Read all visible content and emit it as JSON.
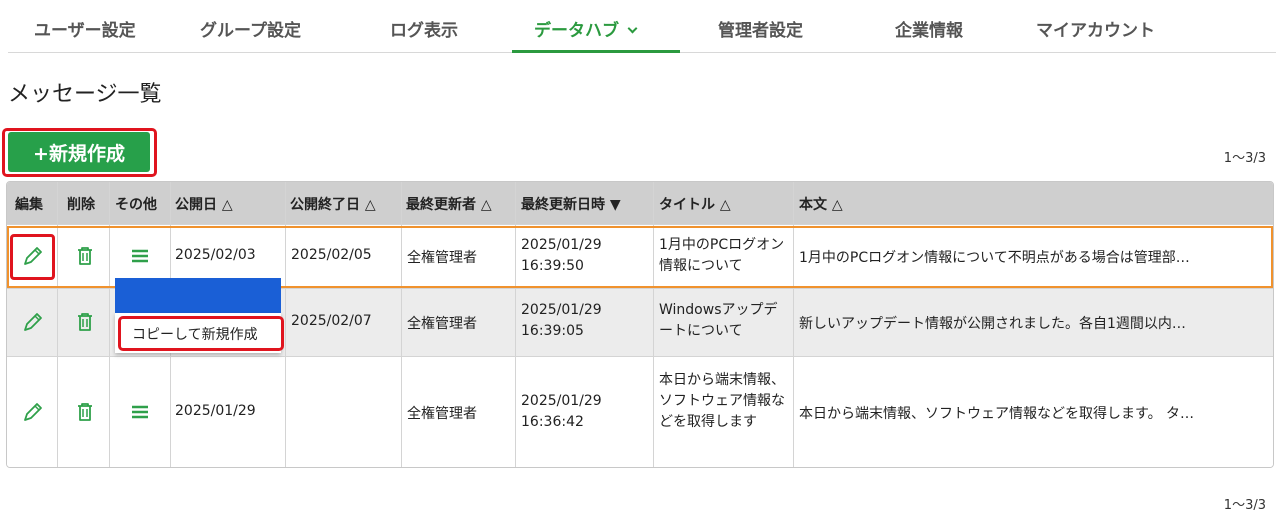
{
  "nav": {
    "items": [
      {
        "label": "ユーザー設定"
      },
      {
        "label": "グループ設定"
      },
      {
        "label": "ログ表示"
      },
      {
        "label": "データハブ"
      },
      {
        "label": "管理者設定"
      },
      {
        "label": "企業情報"
      },
      {
        "label": "マイアカウント"
      }
    ],
    "active": "データハブ"
  },
  "page": {
    "title": "メッセージ一覧",
    "new_button": "+新規作成",
    "pager_top": "1～3/3",
    "pager_bottom": "1～3/3"
  },
  "table": {
    "headers": [
      "編集",
      "削除",
      "その他",
      "公開日 △",
      "公開終了日 △",
      "最終更新者 △",
      "最終更新日時 ▼",
      "タイトル △",
      "本文 △"
    ],
    "rows": [
      {
        "publish_date": "2025/02/03",
        "publish_end": "2025/02/05",
        "updated_by": "全権管理者",
        "updated_date": "2025/01/29",
        "updated_time": "16:39:50",
        "title": "1月中のPCログオン情報について",
        "body": "1月中のPCログオン情報について不明点がある場合は管理部…"
      },
      {
        "publish_date": "",
        "publish_end": "2025/02/07",
        "updated_by": "全権管理者",
        "updated_date": "2025/01/29",
        "updated_time": "16:39:05",
        "title": "Windowsアップデートについて",
        "body": "新しいアップデート情報が公開されました。各自1週間以内…"
      },
      {
        "publish_date": "2025/01/29",
        "publish_end": "",
        "updated_by": "全権管理者",
        "updated_date": "2025/01/29",
        "updated_time": "16:36:42",
        "title": "本日から端末情報、ソフトウェア情報などを取得します",
        "body": "本日から端末情報、ソフトウェア情報などを取得します。 タ…"
      }
    ]
  },
  "context_menu": {
    "item": "コピーして新規作成"
  },
  "icons": {
    "edit": "pencil-icon",
    "delete": "trash-icon",
    "more": "hamburger-menu-icon"
  },
  "colors": {
    "accent_green": "#27a04a",
    "nav_active": "#2b9a3f",
    "highlight_red": "#e0141e",
    "selected_row_orange": "#f0922e",
    "menu_blue": "#1a5fd6"
  }
}
